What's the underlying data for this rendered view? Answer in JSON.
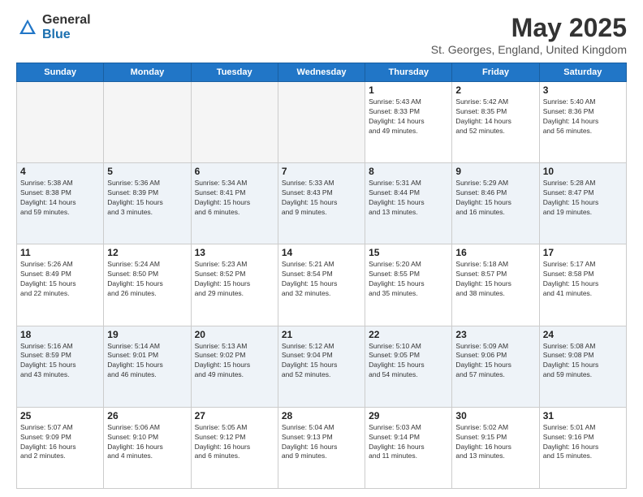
{
  "header": {
    "logo_general": "General",
    "logo_blue": "Blue",
    "month_title": "May 2025",
    "location": "St. Georges, England, United Kingdom"
  },
  "weekdays": [
    "Sunday",
    "Monday",
    "Tuesday",
    "Wednesday",
    "Thursday",
    "Friday",
    "Saturday"
  ],
  "weeks": [
    {
      "row_class": "row-odd",
      "days": [
        {
          "date": "",
          "info": "",
          "empty": true
        },
        {
          "date": "",
          "info": "",
          "empty": true
        },
        {
          "date": "",
          "info": "",
          "empty": true
        },
        {
          "date": "",
          "info": "",
          "empty": true
        },
        {
          "date": "1",
          "info": "Sunrise: 5:43 AM\nSunset: 8:33 PM\nDaylight: 14 hours\nand 49 minutes.",
          "empty": false
        },
        {
          "date": "2",
          "info": "Sunrise: 5:42 AM\nSunset: 8:35 PM\nDaylight: 14 hours\nand 52 minutes.",
          "empty": false
        },
        {
          "date": "3",
          "info": "Sunrise: 5:40 AM\nSunset: 8:36 PM\nDaylight: 14 hours\nand 56 minutes.",
          "empty": false
        }
      ]
    },
    {
      "row_class": "row-even",
      "days": [
        {
          "date": "4",
          "info": "Sunrise: 5:38 AM\nSunset: 8:38 PM\nDaylight: 14 hours\nand 59 minutes.",
          "empty": false
        },
        {
          "date": "5",
          "info": "Sunrise: 5:36 AM\nSunset: 8:39 PM\nDaylight: 15 hours\nand 3 minutes.",
          "empty": false
        },
        {
          "date": "6",
          "info": "Sunrise: 5:34 AM\nSunset: 8:41 PM\nDaylight: 15 hours\nand 6 minutes.",
          "empty": false
        },
        {
          "date": "7",
          "info": "Sunrise: 5:33 AM\nSunset: 8:43 PM\nDaylight: 15 hours\nand 9 minutes.",
          "empty": false
        },
        {
          "date": "8",
          "info": "Sunrise: 5:31 AM\nSunset: 8:44 PM\nDaylight: 15 hours\nand 13 minutes.",
          "empty": false
        },
        {
          "date": "9",
          "info": "Sunrise: 5:29 AM\nSunset: 8:46 PM\nDaylight: 15 hours\nand 16 minutes.",
          "empty": false
        },
        {
          "date": "10",
          "info": "Sunrise: 5:28 AM\nSunset: 8:47 PM\nDaylight: 15 hours\nand 19 minutes.",
          "empty": false
        }
      ]
    },
    {
      "row_class": "row-odd",
      "days": [
        {
          "date": "11",
          "info": "Sunrise: 5:26 AM\nSunset: 8:49 PM\nDaylight: 15 hours\nand 22 minutes.",
          "empty": false
        },
        {
          "date": "12",
          "info": "Sunrise: 5:24 AM\nSunset: 8:50 PM\nDaylight: 15 hours\nand 26 minutes.",
          "empty": false
        },
        {
          "date": "13",
          "info": "Sunrise: 5:23 AM\nSunset: 8:52 PM\nDaylight: 15 hours\nand 29 minutes.",
          "empty": false
        },
        {
          "date": "14",
          "info": "Sunrise: 5:21 AM\nSunset: 8:54 PM\nDaylight: 15 hours\nand 32 minutes.",
          "empty": false
        },
        {
          "date": "15",
          "info": "Sunrise: 5:20 AM\nSunset: 8:55 PM\nDaylight: 15 hours\nand 35 minutes.",
          "empty": false
        },
        {
          "date": "16",
          "info": "Sunrise: 5:18 AM\nSunset: 8:57 PM\nDaylight: 15 hours\nand 38 minutes.",
          "empty": false
        },
        {
          "date": "17",
          "info": "Sunrise: 5:17 AM\nSunset: 8:58 PM\nDaylight: 15 hours\nand 41 minutes.",
          "empty": false
        }
      ]
    },
    {
      "row_class": "row-even",
      "days": [
        {
          "date": "18",
          "info": "Sunrise: 5:16 AM\nSunset: 8:59 PM\nDaylight: 15 hours\nand 43 minutes.",
          "empty": false
        },
        {
          "date": "19",
          "info": "Sunrise: 5:14 AM\nSunset: 9:01 PM\nDaylight: 15 hours\nand 46 minutes.",
          "empty": false
        },
        {
          "date": "20",
          "info": "Sunrise: 5:13 AM\nSunset: 9:02 PM\nDaylight: 15 hours\nand 49 minutes.",
          "empty": false
        },
        {
          "date": "21",
          "info": "Sunrise: 5:12 AM\nSunset: 9:04 PM\nDaylight: 15 hours\nand 52 minutes.",
          "empty": false
        },
        {
          "date": "22",
          "info": "Sunrise: 5:10 AM\nSunset: 9:05 PM\nDaylight: 15 hours\nand 54 minutes.",
          "empty": false
        },
        {
          "date": "23",
          "info": "Sunrise: 5:09 AM\nSunset: 9:06 PM\nDaylight: 15 hours\nand 57 minutes.",
          "empty": false
        },
        {
          "date": "24",
          "info": "Sunrise: 5:08 AM\nSunset: 9:08 PM\nDaylight: 15 hours\nand 59 minutes.",
          "empty": false
        }
      ]
    },
    {
      "row_class": "row-odd",
      "days": [
        {
          "date": "25",
          "info": "Sunrise: 5:07 AM\nSunset: 9:09 PM\nDaylight: 16 hours\nand 2 minutes.",
          "empty": false
        },
        {
          "date": "26",
          "info": "Sunrise: 5:06 AM\nSunset: 9:10 PM\nDaylight: 16 hours\nand 4 minutes.",
          "empty": false
        },
        {
          "date": "27",
          "info": "Sunrise: 5:05 AM\nSunset: 9:12 PM\nDaylight: 16 hours\nand 6 minutes.",
          "empty": false
        },
        {
          "date": "28",
          "info": "Sunrise: 5:04 AM\nSunset: 9:13 PM\nDaylight: 16 hours\nand 9 minutes.",
          "empty": false
        },
        {
          "date": "29",
          "info": "Sunrise: 5:03 AM\nSunset: 9:14 PM\nDaylight: 16 hours\nand 11 minutes.",
          "empty": false
        },
        {
          "date": "30",
          "info": "Sunrise: 5:02 AM\nSunset: 9:15 PM\nDaylight: 16 hours\nand 13 minutes.",
          "empty": false
        },
        {
          "date": "31",
          "info": "Sunrise: 5:01 AM\nSunset: 9:16 PM\nDaylight: 16 hours\nand 15 minutes.",
          "empty": false
        }
      ]
    }
  ]
}
